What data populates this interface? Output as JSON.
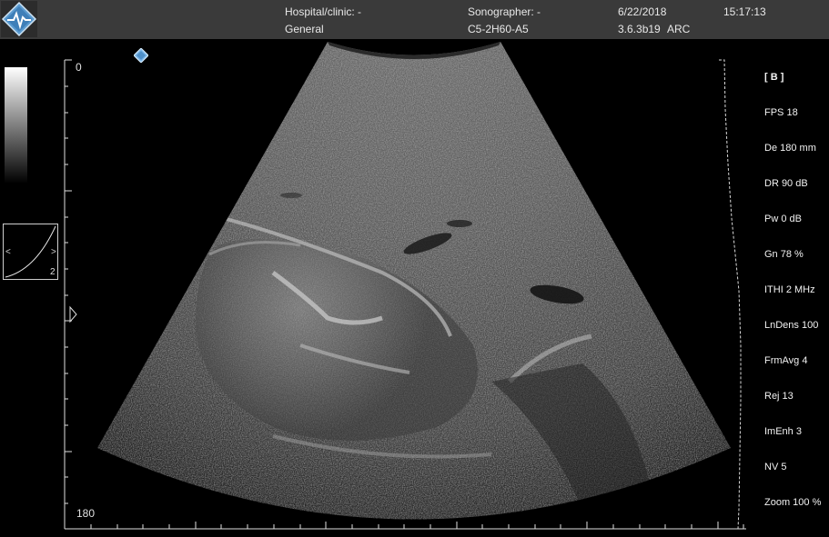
{
  "header": {
    "hospital_label": "Hospital/clinic: -",
    "preset": "General",
    "sonographer_label": "Sonographer: -",
    "probe": "C5-2H60-A5",
    "date": "6/22/2018",
    "version": "3.6.3b19",
    "mode": "ARC",
    "time": "15:17:13"
  },
  "depth_scale": {
    "top_label": "0",
    "bottom_label": "180"
  },
  "gain_curve": {
    "index": "2",
    "left_arrow": "<",
    "right_arrow": ">"
  },
  "side_panel": {
    "mode_title": "[ B ]",
    "params": [
      "FPS 18",
      "De 180 mm",
      "DR 90 dB",
      "Pw 0 dB",
      "Gn 78 %",
      "ITHI 2 MHz",
      "LnDens 100",
      "FrmAvg 4",
      "Rej 13",
      "ImEnh 3",
      "NV 5",
      "Zoom 100 %"
    ]
  },
  "icons": {
    "logo": "logo-icon",
    "focus_marker": "focus-marker-icon",
    "pointer": "pointer-arrow-icon"
  },
  "colors": {
    "header_bg": "#3a3a3a",
    "logo_blue": "#4a90c8"
  }
}
